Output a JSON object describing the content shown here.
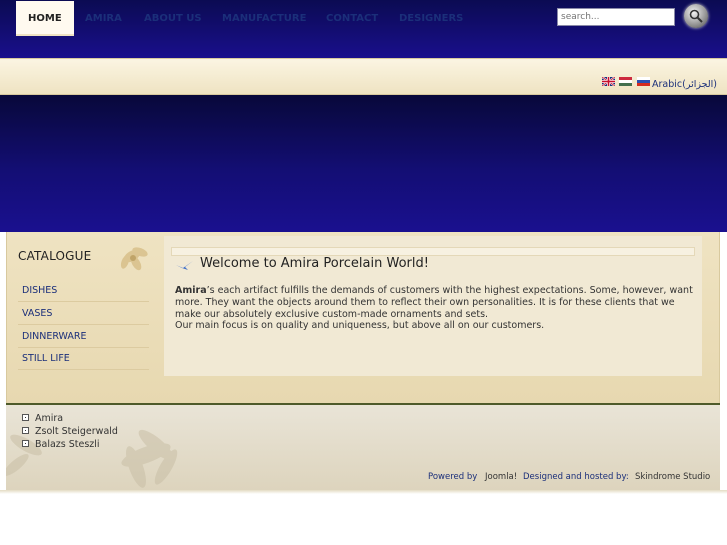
{
  "search": {
    "placeholder": "search..."
  },
  "nav": {
    "items": [
      {
        "label": "HOME"
      },
      {
        "label": "AMIRA"
      },
      {
        "label": "ABOUT US"
      },
      {
        "label": "MANUFACTURE"
      },
      {
        "label": "CONTACT"
      },
      {
        "label": "DESIGNERS"
      }
    ],
    "active": "HOME"
  },
  "languages": {
    "flags": [
      "english-flag-icon",
      "hungarian-flag-icon",
      "russian-flag-icon"
    ],
    "arabic_label": "Arabic(الجزائر)"
  },
  "catalogue": {
    "title": "CATALOGUE",
    "items": [
      {
        "label": "DISHES"
      },
      {
        "label": "VASES"
      },
      {
        "label": "DINNERWARE"
      },
      {
        "label": "STILL LIFE"
      }
    ]
  },
  "article": {
    "title": "Welcome to Amira Porcelain World!",
    "brand": "Amira",
    "p1": "’s each artifact fulfills the demands of customers with the highest expectations. Some, however, want more. They want the objects around them to reflect their own personalities. It is for these clients that we make our absolutely exclusive custom-made ornaments and sets.",
    "p2": "Our main focus is on quality and uniqueness, but above all on our customers."
  },
  "footer": {
    "links": [
      {
        "label": "Amira"
      },
      {
        "label": "Zsolt Steigerwald"
      },
      {
        "label": "Balazs Steszli"
      }
    ],
    "powered_by": "Powered by",
    "joomla": "Joomla!",
    "designed_by": "Designed and hosted by:",
    "studio": "Skindrome Studio"
  },
  "colors": {
    "header_blue": "#1a0f8e",
    "nav_link": "#1b2f7a",
    "cream": "#efe3c2"
  }
}
